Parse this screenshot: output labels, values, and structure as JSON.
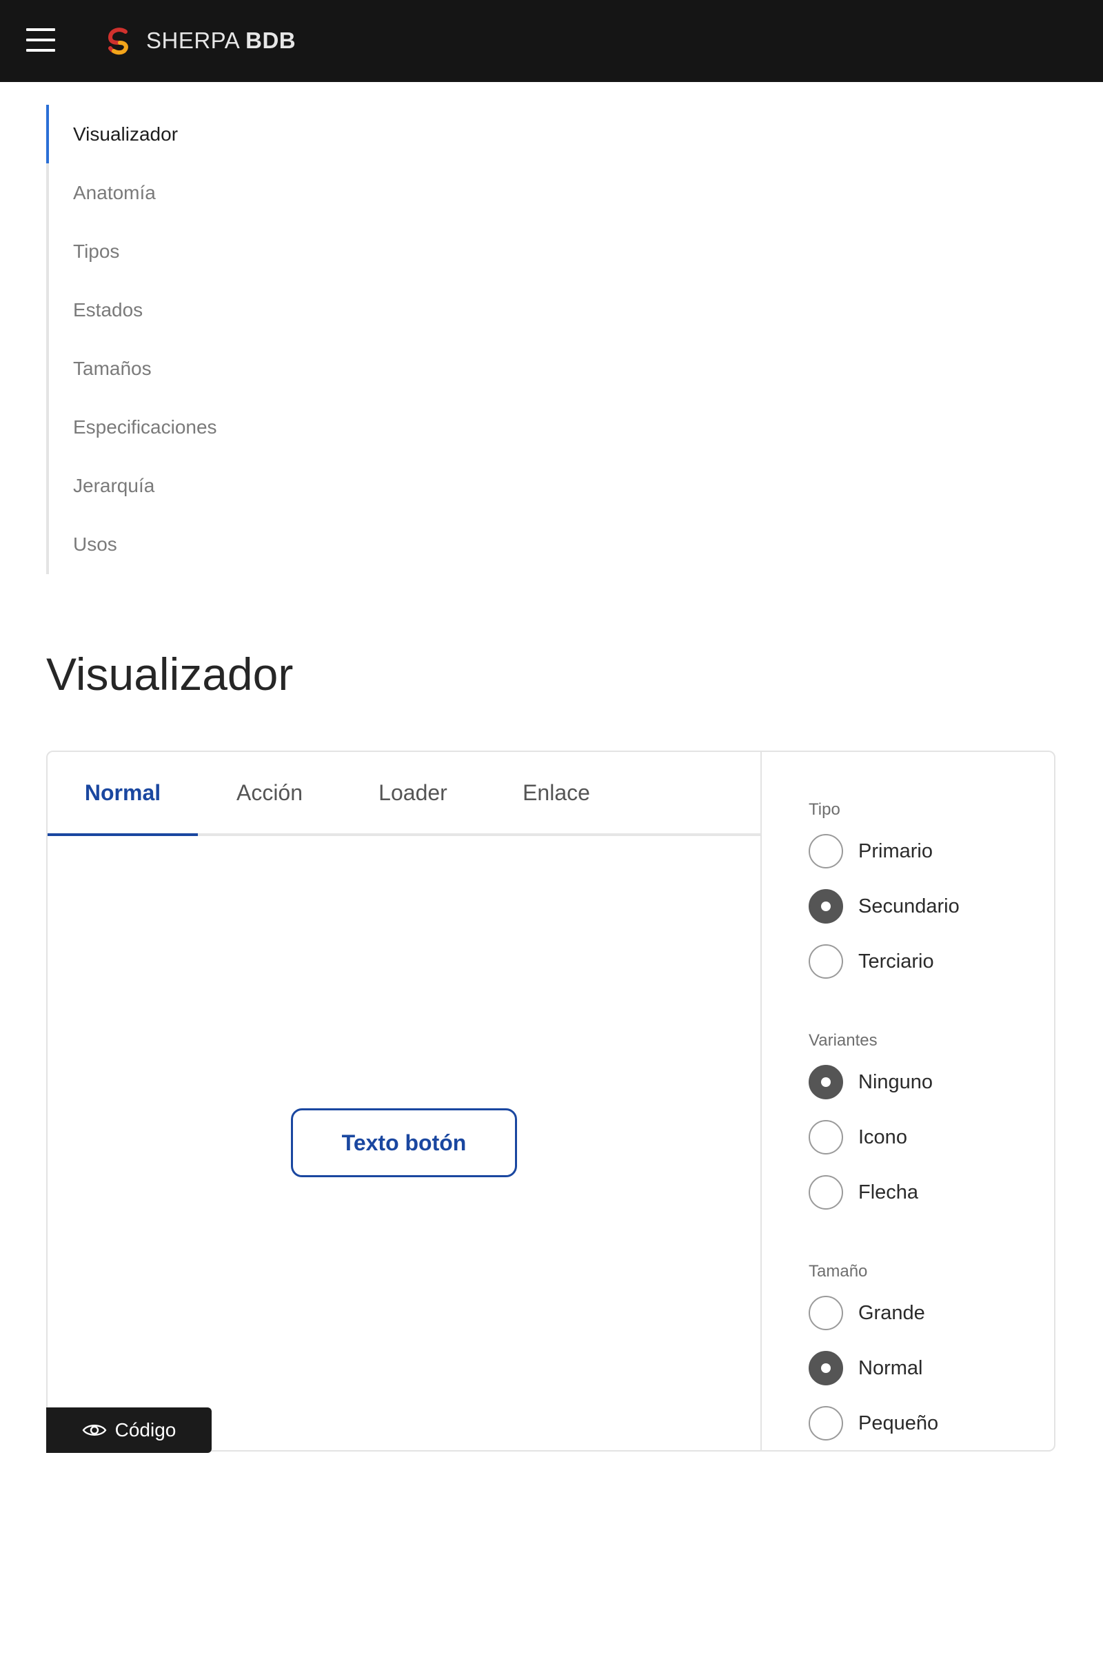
{
  "header": {
    "brand_name": "SHERPA",
    "brand_suffix": "BDB",
    "menu_icon": "hamburger-menu-icon",
    "logo": "sherpa-logo"
  },
  "sidenav": {
    "items": [
      {
        "label": "Visualizador",
        "active": true
      },
      {
        "label": "Anatomía",
        "active": false
      },
      {
        "label": "Tipos",
        "active": false
      },
      {
        "label": "Estados",
        "active": false
      },
      {
        "label": "Tamaños",
        "active": false
      },
      {
        "label": "Especificaciones",
        "active": false
      },
      {
        "label": "Jerarquía",
        "active": false
      },
      {
        "label": "Usos",
        "active": false
      }
    ]
  },
  "main": {
    "section_title": "Visualizador",
    "tabs": [
      {
        "label": "Normal",
        "active": true
      },
      {
        "label": "Acción",
        "active": false
      },
      {
        "label": "Loader",
        "active": false
      },
      {
        "label": "Enlace",
        "active": false
      }
    ],
    "preview_button_label": "Texto botón",
    "code_button_label": "Código",
    "code_icon": "eye-icon"
  },
  "options": {
    "tipo": {
      "label": "Tipo",
      "choices": [
        "Primario",
        "Secundario",
        "Terciario"
      ],
      "selected": "Secundario"
    },
    "variantes": {
      "label": "Variantes",
      "choices": [
        "Ninguno",
        "Icono",
        "Flecha"
      ],
      "selected": "Ninguno"
    },
    "tamano": {
      "label": "Tamaño",
      "choices": [
        "Grande",
        "Normal",
        "Pequeño"
      ],
      "selected": "Normal"
    }
  },
  "colors": {
    "header_bg": "#151515",
    "accent_blue": "#1a47a0",
    "nav_active_bar": "#2a6fd6",
    "radio_checked": "#555555"
  }
}
